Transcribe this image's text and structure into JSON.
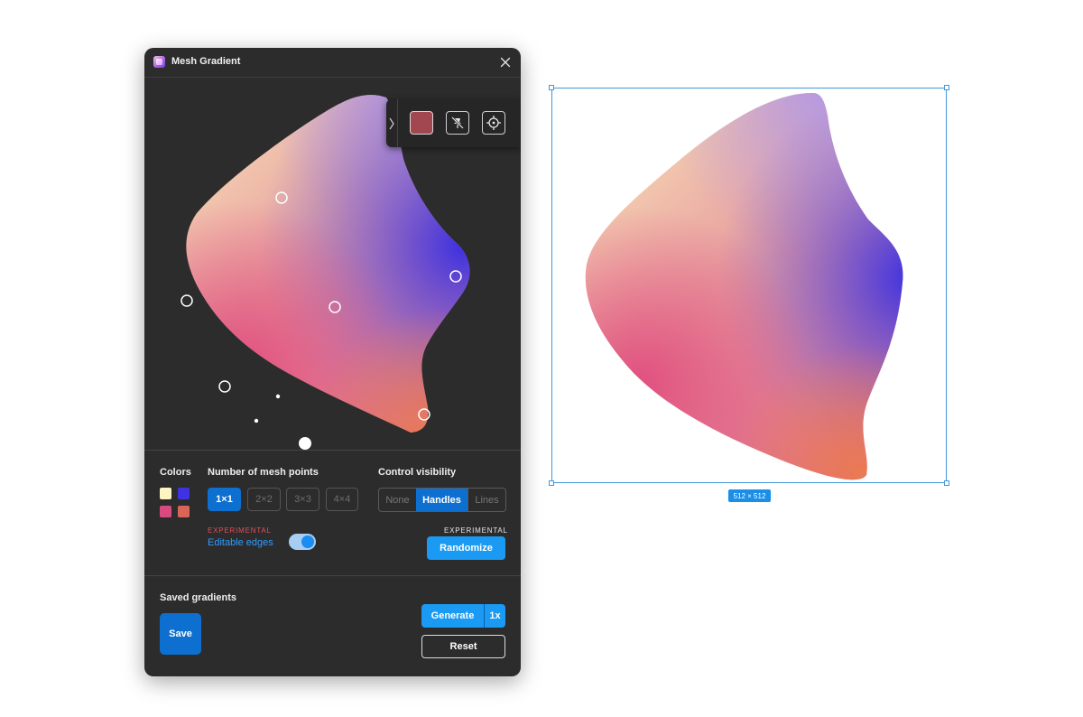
{
  "window": {
    "title": "Mesh Gradient"
  },
  "colors": {
    "label": "Colors",
    "swatches": [
      "#fdf3c3",
      "#3f32e0",
      "#d94b7f",
      "#d96558"
    ],
    "selected_point_color": "#a24650"
  },
  "mesh_points": {
    "label": "Number of mesh points",
    "options": [
      "1×1",
      "2×2",
      "3×3",
      "4×4"
    ],
    "selected": "1×1"
  },
  "control_visibility": {
    "label": "Control visibility",
    "options": [
      "None",
      "Handles",
      "Lines"
    ],
    "selected": "Handles"
  },
  "experimental_label": "EXPERIMENTAL",
  "editable_edges": {
    "label": "Editable edges",
    "enabled": true
  },
  "randomize_label": "Randomize",
  "saved_gradients": {
    "label": "Saved gradients",
    "save_label": "Save"
  },
  "generate": {
    "label": "Generate",
    "scale": "1x"
  },
  "reset_label": "Reset",
  "canvas": {
    "size_badge": "512 × 512"
  },
  "icons": [
    "close-icon",
    "chevron-right-icon",
    "hide-point-icon",
    "target-icon",
    "plugin-icon"
  ]
}
